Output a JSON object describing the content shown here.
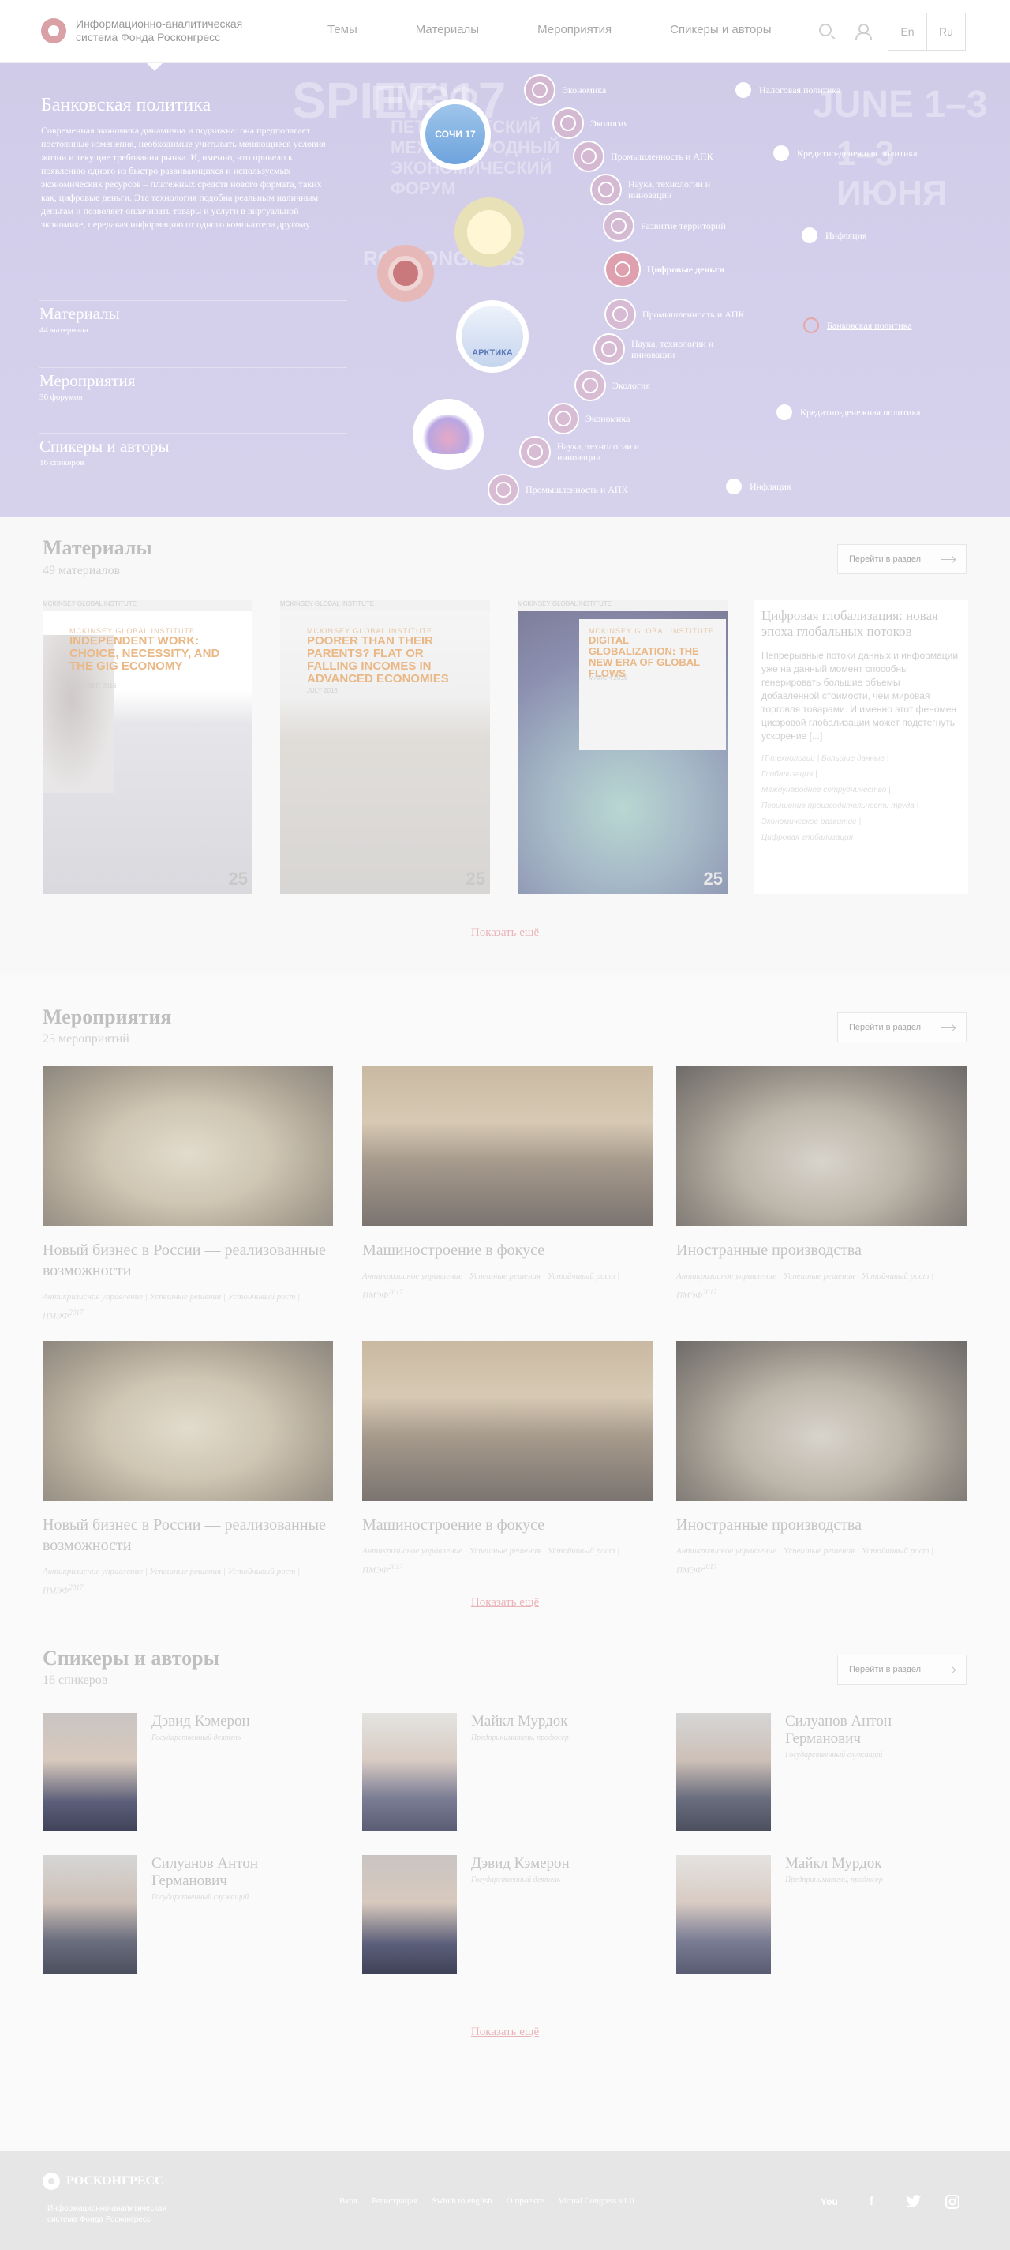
{
  "header": {
    "logo_text": "Информационно-аналитическая система Фонда Росконгресс",
    "nav": [
      "Темы",
      "Материалы",
      "Мероприятия",
      "Спикеры и авторы"
    ],
    "lang_en": "En",
    "lang_ru": "Ru"
  },
  "hero": {
    "bg_texts": [
      "SPIEF'17",
      "ПМЭФ",
      "ПЕТЕРБУРГСКИЙ",
      "МЕЖДУНАРОДНЫЙ",
      "ЭКОНОМИЧЕСКИЙ",
      "ФОРУМ",
      "JUNE 1–3",
      "1–3 ИЮНЯ",
      "ROSCONGRESS"
    ],
    "title": "Банковская политика",
    "text": "Современная экономика динамична и подвижна: она предполагает постоянные изменения, необходимые учитывать меняющиеся условия жизни и текущие требования рынка. И, именно, что привело к появлению одного из быстро развивающихся и используемых экономических ресурсов – платежных средств нового формата, таких как, цифровые деньги. Эта технология подобна реальным наличным деньгам и позволяет оплачивать товары и услуги в виртуальной экономике, передавая информацию от одного компьютера другому.",
    "sections": [
      {
        "title": "Материалы",
        "sub": "44 материала"
      },
      {
        "title": "Мероприятия",
        "sub": "36 форумов"
      },
      {
        "title": "Спикеры и авторы",
        "sub": "16 спикеров"
      }
    ],
    "circles": [
      {
        "label": "СОЧИ 17"
      },
      {
        "label": ""
      },
      {
        "label": ""
      },
      {
        "label": "АРКТИКА"
      },
      {
        "label": ""
      }
    ],
    "topics": [
      "Экономика",
      "Экология",
      "Промышленность и АПК",
      "Наука, технологии и инновации",
      "Развитие территорий",
      "Цифровые деньги",
      "Промышленность и АПК",
      "Наука, технологии и инновации",
      "Экология",
      "Экономика",
      "Наука, технологии и инновации",
      "Промышленность и АПК"
    ],
    "subtopics": [
      "Налоговая политика",
      "Кредитно-денежная политика",
      "Инфляция",
      "Банковская политика",
      "Кредитно-денежная политика",
      "Инфляция"
    ]
  },
  "materials": {
    "title": "Материалы",
    "count": "49 материалов",
    "goto": "Перейти в раздел",
    "cards": [
      {
        "badge": "MCKINSEY GLOBAL INSTITUTE",
        "title": "INDEPENDENT WORK: CHOICE, NECESSITY, AND THE GIG ECONOMY",
        "author": "OCTOBER 2016",
        "num": "25",
        "head": "MCKINSEY GLOBAL INSTITUTE"
      },
      {
        "badge": "MCKINSEY GLOBAL INSTITUTE",
        "title": "POORER THAN THEIR PARENTS? FLAT OR FALLING INCOMES IN ADVANCED ECONOMIES",
        "author": "JULY 2016",
        "num": "25",
        "head": "MCKINSEY GLOBAL INSTITUTE"
      },
      {
        "badge": "MCKINSEY GLOBAL INSTITUTE",
        "title": "DIGITAL GLOBALIZATION: THE NEW ERA OF GLOBAL FLOWS",
        "author": "MARCH 2016",
        "num": "25",
        "head": "MCKINSEY GLOBAL INSTITUTE"
      }
    ],
    "desc": {
      "title": "Цифровая глобализация: новая эпоха глобальных потоков",
      "text": "Непрерывные потоки данных и информации уже на данный момент способны генерировать большие объемы добавленной стоимости, чем мировая торговля товарами. И именно этот феномен цифровой глобализации может подстегнуть ускорение [...]",
      "tags": [
        "IT-технологии | Большие данные |",
        "Глобализация |",
        "Международное сотрудничество |",
        "Повышение производительности труда |",
        "Экономическое развитие |",
        "Цифровая глобализация"
      ]
    },
    "more": "Показать ещё"
  },
  "events": {
    "title": "Мероприятия",
    "count": "25 мероприятий",
    "goto": "Перейти в раздел",
    "items": [
      {
        "title": "Новый бизнес в России — реализованные возможности",
        "tags": "Антикризисное управление | Успешные решения | Устойчивый рост | ПМЭФ",
        "sup": "2017"
      },
      {
        "title": "Машиностроение в фокусе",
        "tags": "Антикризисное управление | Успешные решения | Устойчивый рост | ПМЭФ",
        "sup": "2017"
      },
      {
        "title": "Иностранные производства",
        "tags": "Антикризисное управление | Успешные решения | Устойчивый рост | ПМЭФ",
        "sup": "2017"
      },
      {
        "title": "Новый бизнес в России — реализованные возможности",
        "tags": "Антикризисное управление | Успешные решения | Устойчивый рост | ПМЭФ",
        "sup": "2017"
      },
      {
        "title": "Машиностроение в фокусе",
        "tags": "Антикризисное управление | Успешные решения | Устойчивый рост | ПМЭФ",
        "sup": "2017"
      },
      {
        "title": "Иностранные производства",
        "tags": "Антикризисное управление | Успешные решения | Устойчивый рост | ПМЭФ",
        "sup": "2017"
      }
    ],
    "more": "Показать ещё"
  },
  "speakers": {
    "title": "Спикеры и авторы",
    "count": "16 спикеров",
    "goto": "Перейти в раздел",
    "items": [
      {
        "name": "Дэвид Кэмерон",
        "role": "Государственный деятель"
      },
      {
        "name": "Майкл Мурдок",
        "role": "Предприниматель, продюсер"
      },
      {
        "name": "Силуанов Антон Германович",
        "role": "Государственный служащий"
      },
      {
        "name": "Силуанов Антон Германович",
        "role": "Государственный служащий"
      },
      {
        "name": "Дэвид Кэмерон",
        "role": "Государственный деятель"
      },
      {
        "name": "Майкл Мурдок",
        "role": "Предприниматель, продюсер"
      }
    ],
    "more": "Показать ещё"
  },
  "footer": {
    "logo": "РОСКОНГРЕСС",
    "sub": "Информационно-аналитическая система Фонда Росконгресс",
    "links": [
      "Вход",
      "Регистрация",
      "Switch to english",
      "О проекте",
      "Virtual Congress v1.0"
    ],
    "social": [
      "youtube-icon",
      "facebook-icon",
      "twitter-icon",
      "instagram-icon"
    ],
    "youtube_label": "You"
  },
  "colors": {
    "hero_bg": "#d2cee9",
    "accent": "#e6a6a6",
    "footer_bg": "#e6e6e6"
  }
}
